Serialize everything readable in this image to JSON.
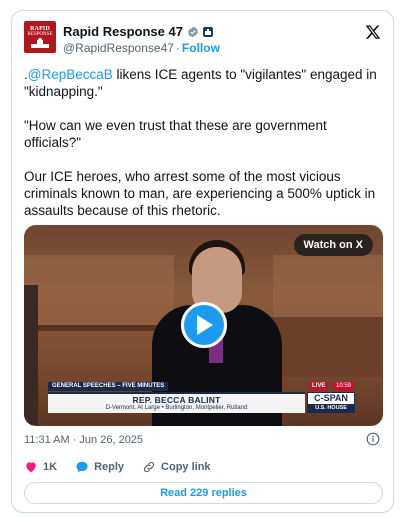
{
  "author": {
    "avatar_line1": "RAPID",
    "avatar_line2": "RESPONSE",
    "name": "Rapid Response 47",
    "handle": "@RapidResponse47",
    "separator": "·",
    "follow_label": "Follow"
  },
  "tweet": {
    "mention": "@RepBeccaB",
    "line1_prefix": ".",
    "line1_rest": " likens ICE agents to \"vigilantes\" engaged in \"kidnapping.\"",
    "paragraph2": "\"How can we even trust that these are government officials?\"",
    "paragraph3": "Our ICE heroes, who arrest some of the most vicious criminals known to man, are experiencing a 500% uptick in assaults because of this rhetoric."
  },
  "video": {
    "watch_label": "Watch on X",
    "lower_third_tag": "GENERAL SPEECHES – FIVE MINUTES",
    "lower_third_name": "REP. BECCA BALINT",
    "lower_third_sub": "D-Vermont, At Large  •  Burlington, Montpelier, Rutland",
    "live_label": "LIVE",
    "live_time": "10:59",
    "cspan_label": "C-SPAN",
    "cspan_sub": "U.S. HOUSE"
  },
  "meta": {
    "timestamp": "11:31 AM · Jun 26, 2025"
  },
  "actions": {
    "likes": "1K",
    "reply_label": "Reply",
    "copy_link_label": "Copy link"
  },
  "footer": {
    "read_replies_label": "Read 229 replies"
  },
  "colors": {
    "accent": "#1d9bf0",
    "like": "#f91880",
    "secondary_text": "#536471",
    "border": "#cfd9de"
  }
}
